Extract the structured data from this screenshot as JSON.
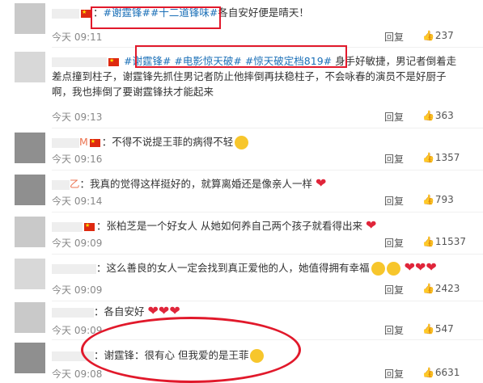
{
  "comments": [
    {
      "prefix": "：",
      "tag": "#谢霆锋##十二道锋味#",
      "rest": "各自安好便是晴天！",
      "time": "今天 09:11",
      "reply": "回复",
      "likes": "237"
    },
    {
      "tag": "#谢霆锋# #电影惊天破# #惊天破定档819#",
      "rest": "身手好敏捷，男记者倒着走差点撞到柱子，谢霆锋先抓住男记者防止他摔倒再扶稳柱子，不会咏春的演员不是好厨子啊，我也摔倒了要谢霆锋扶才能起来",
      "time": "今天 09:13",
      "reply": "回复",
      "likes": "363"
    },
    {
      "name_suffix": "M",
      "text": "：不得不说提王菲的病得不轻",
      "time": "今天 09:16",
      "reply": "回复",
      "likes": "1357"
    },
    {
      "name_suffix": "乙",
      "text": "：我真的觉得这样挺好的，就算离婚还是像亲人一样",
      "time": "今天 09:14",
      "reply": "回复",
      "likes": "793"
    },
    {
      "text": "：张柏芝是一个好女人 从她如何养自己两个孩子就看得出来",
      "time": "今天 09:09",
      "reply": "回复",
      "likes": "11537"
    },
    {
      "text": "：这么善良的女人一定会找到真正爱他的人，她值得拥有幸福",
      "time": "今天 09:09",
      "reply": "回复",
      "likes": "2423"
    },
    {
      "text": "：各自安好",
      "time": "今天 09:09",
      "reply": "回复",
      "likes": "547"
    },
    {
      "text": "：谢霆锋：很有心 但我爱的是王菲",
      "time": "今天 09:08",
      "reply": "回复",
      "likes": "6631"
    }
  ],
  "colors": {
    "link": "#1a6fb7",
    "name": "#eb7350",
    "highlight": "#e1192b"
  }
}
